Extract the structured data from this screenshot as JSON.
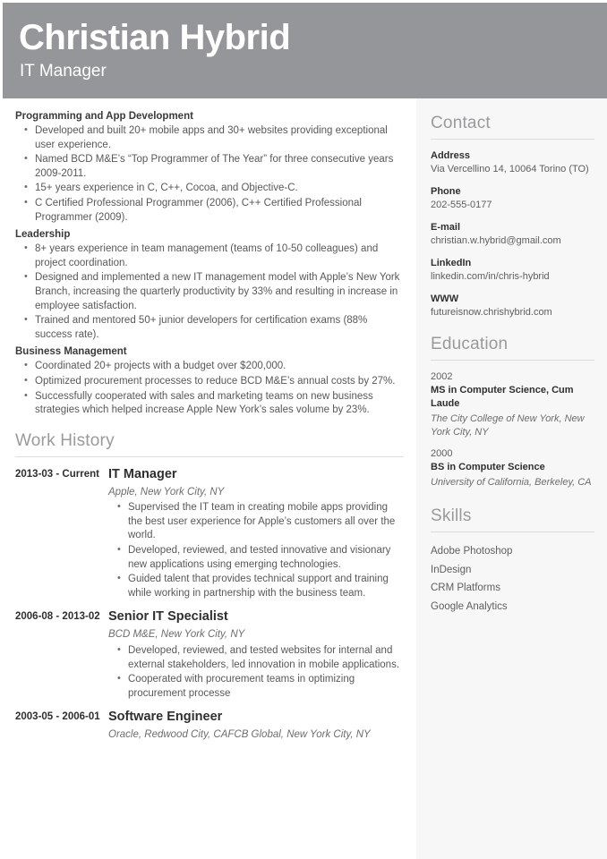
{
  "header": {
    "name": "Christian Hybrid",
    "job_title": "IT Manager",
    "background_color": "#949699",
    "text_color": "#ffffff"
  },
  "summary": {
    "groups": [
      {
        "heading": "Programming and App Development",
        "bullets": [
          "Developed and built 20+ mobile apps and 30+ websites providing exceptional user experience.",
          "Named BCD M&E’s “Top Programmer of The Year” for three consecutive years 2009-2011.",
          "15+ years experience in C, C++, Cocoa, and Objective-C.",
          "C Certified Professional Programmer (2006), C++ Certified Professional Programmer (2009)."
        ]
      },
      {
        "heading": "Leadership",
        "bullets": [
          "8+ years experience in team management (teams of 10-50 colleagues) and project coordination.",
          "Designed and implemented a new IT management model with Apple’s New York Branch, increasing the quarterly productivity by 33% and resulting in increase in employee satisfaction.",
          "Trained and mentored 50+ junior developers for certification exams (88% success rate)."
        ]
      },
      {
        "heading": "Business Management",
        "bullets": [
          "Coordinated 20+ projects with a budget over $200,000.",
          "Optimized procurement processes to reduce BCD M&E’s annual costs by 27%.",
          "Successfully cooperated with sales and marketing teams on new business strategies which helped increase Apple New York’s sales volume by 23%."
        ]
      }
    ]
  },
  "work_history": {
    "heading": "Work History",
    "jobs": [
      {
        "dates": "2013-03 - Current",
        "title": "IT Manager",
        "company": "Apple, New York City, NY",
        "bullets": [
          "Supervised the IT team in creating mobile apps providing the best user experience for Apple’s customers all over the world.",
          "Developed, reviewed, and tested innovative and visionary new applications using emerging technologies.",
          "Guided talent that provides technical support and training while working in partnership with the business team."
        ]
      },
      {
        "dates": "2006-08 - 2013-02",
        "title": "Senior IT Specialist",
        "company": "BCD M&E, New York City, NY",
        "bullets": [
          "Developed, reviewed, and tested websites for internal and external stakeholders, led innovation in mobile applications.",
          "Cooperated with procurement teams in optimizing procurement processe"
        ]
      },
      {
        "dates": "2003-05 - 2006-01",
        "title": "Software Engineer",
        "company": "Oracle, Redwood City, CAFCB Global, New York City, NY",
        "bullets": []
      }
    ]
  },
  "sidebar": {
    "background_color": "#f7f7f7",
    "contact": {
      "heading": "Contact",
      "fields": [
        {
          "label": "Address",
          "value": "Via Vercellino 14, 10064 Torino (TO)"
        },
        {
          "label": "Phone",
          "value": "202-555-0177"
        },
        {
          "label": "E-mail",
          "value": "christian.w.hybrid@gmail.com"
        },
        {
          "label": "LinkedIn",
          "value": "linkedin.com/in/chris-hybrid"
        },
        {
          "label": "WWW",
          "value": "futureisnow.chrishybrid.com"
        }
      ]
    },
    "education": {
      "heading": "Education",
      "entries": [
        {
          "year": "2002",
          "degree": "MS in Computer Science, Cum Laude",
          "school": "The City College of New York, New York City, NY"
        },
        {
          "year": "2000",
          "degree": "BS in Computer Science",
          "school": "University of California, Berkeley, CA"
        }
      ]
    },
    "skills": {
      "heading": "Skills",
      "items": [
        "Adobe Photoshop",
        "InDesign",
        "CRM Platforms",
        "Google Analytics"
      ]
    }
  }
}
